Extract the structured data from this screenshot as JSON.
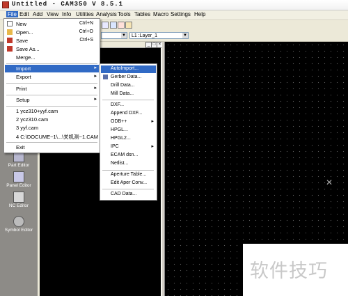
{
  "window": {
    "title": "Untitled - CAM350 V 8.5.1"
  },
  "menubar": [
    "File",
    "Edit",
    "Add",
    "View",
    "Info",
    "Utilities",
    "Analysis",
    "Tools",
    "Tables",
    "Macro",
    "Settings",
    "Help"
  ],
  "toolbar": {
    "layer_combo": "L1 :Layer_1"
  },
  "file_menu": {
    "new": "New",
    "new_sc": "Ctrl+N",
    "open": "Open...",
    "open_sc": "Ctrl+O",
    "save": "Save",
    "save_sc": "Ctrl+S",
    "save_as": "Save As...",
    "merge": "Merge...",
    "import": "Import",
    "export": "Export",
    "print": "Print",
    "setup": "Setup",
    "recent1": "1 ycz310+yyf.cam",
    "recent2": "2 ycz310.cam",
    "recent3": "3 yyf.cam",
    "recent4": "4 C:\\DOCUME~1\\...\\关机测~1.CAM",
    "exit": "Exit"
  },
  "import_menu": {
    "autoimport": "AutoImport...",
    "gerber": "Gerber Data...",
    "drill": "Drill Data...",
    "mill": "Mill Data...",
    "dxf": "DXF...",
    "append_dxf": "Append DXF...",
    "odb": "ODB++",
    "hpgl": "HPGL...",
    "hpgl2": "HPGL2...",
    "ipc": "IPC",
    "ecam": "ECAM dsn...",
    "netlist": "Netlist...",
    "aperture": "Aperture Table...",
    "edit_aper": "Edit Aper Conv...",
    "cad": "CAD Data..."
  },
  "left_tools": {
    "part_editor": "Part Editor",
    "panel_editor": "Panel Editor",
    "nc_editor": "NC Editor",
    "symbol_editor": "Symbol Editor"
  },
  "watermark": "软件技巧"
}
